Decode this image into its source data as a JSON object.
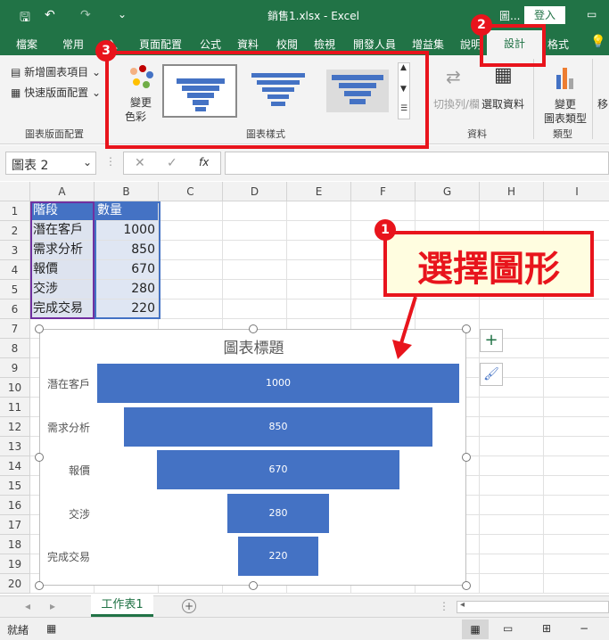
{
  "window": {
    "title": "銷售1.xlsx  -  Excel",
    "account_short": "圖...",
    "login": "登入"
  },
  "tabs": [
    "檔案",
    "常用",
    "入",
    "頁面配置",
    "公式",
    "資料",
    "校閱",
    "檢視",
    "開發人員",
    "增益集",
    "說明",
    "設計",
    "格式"
  ],
  "ribbon": {
    "add_element": "新增圖表項目",
    "quick_layout": "快速版面配置",
    "group_layout": "圖表版面配置",
    "change_colors_1": "變更",
    "change_colors_2": "色彩",
    "group_styles": "圖表樣式",
    "switch_row_col": "切換列/欄",
    "select_data": "選取資料",
    "group_data": "資料",
    "change_type_1": "變更",
    "change_type_2": "圖表類型",
    "group_type": "類型",
    "group_more": "移"
  },
  "formula_bar": {
    "name_box": "圖表 2",
    "fx": "fx"
  },
  "columns": [
    "A",
    "B",
    "C",
    "D",
    "E",
    "F",
    "G",
    "H",
    "I"
  ],
  "rows": [
    "1",
    "2",
    "3",
    "4",
    "5",
    "6",
    "7",
    "8",
    "9",
    "10",
    "11",
    "12",
    "13",
    "14",
    "15",
    "16",
    "17",
    "18",
    "19",
    "20"
  ],
  "table": {
    "header": [
      "階段",
      "數量"
    ],
    "rows": [
      [
        "潛在客戶",
        "1000"
      ],
      [
        "需求分析",
        "850"
      ],
      [
        "報價",
        "670"
      ],
      [
        "交涉",
        "280"
      ],
      [
        "完成交易",
        "220"
      ]
    ]
  },
  "annotations": {
    "badge1": "1",
    "badge2": "2",
    "badge3": "3",
    "callout_text": "選擇圖形"
  },
  "chart_data": {
    "type": "bar",
    "title": "圖表標題",
    "categories": [
      "潛在客戶",
      "需求分析",
      "報價",
      "交涉",
      "完成交易"
    ],
    "values": [
      1000,
      850,
      670,
      280,
      220
    ],
    "bar_color": "#4472c4",
    "orientation": "funnel"
  },
  "sheet": {
    "tab": "工作表1"
  },
  "status": {
    "ready": "就緒"
  }
}
